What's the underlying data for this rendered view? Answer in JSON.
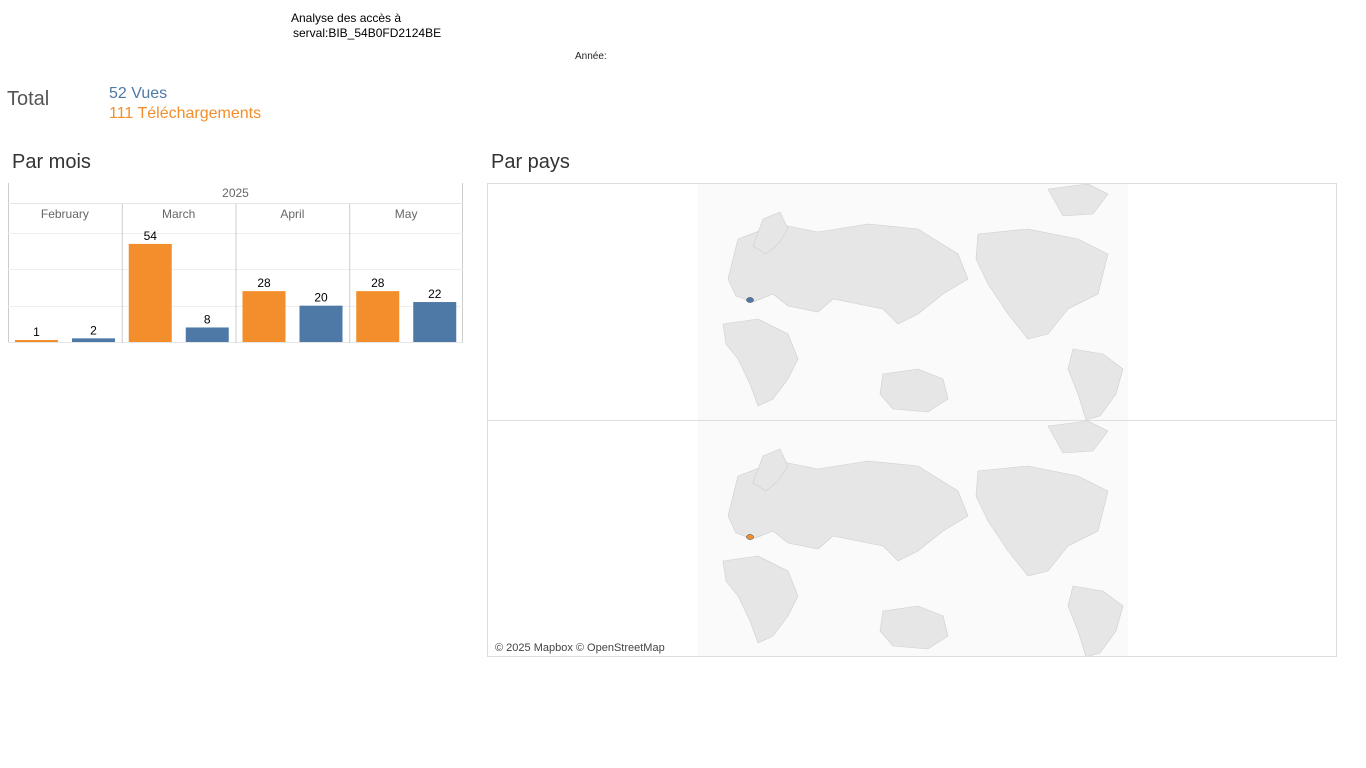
{
  "header": {
    "title_line1": "Analyse des accès à",
    "title_line2": "serval:BIB_54B0FD2124BE",
    "year_filter_label": "Année:"
  },
  "totals": {
    "label": "Total",
    "views_value": "52",
    "views_label": "Vues",
    "downloads_value": "111",
    "downloads_label": "Téléchargements"
  },
  "sections": {
    "by_month": "Par mois",
    "by_country": "Par pays"
  },
  "colors": {
    "views": "#4e79a7",
    "downloads": "#f28e2b"
  },
  "chart_data": {
    "type": "bar",
    "year": "2025",
    "categories": [
      "February",
      "March",
      "April",
      "May"
    ],
    "series": [
      {
        "name": "Téléchargements",
        "values": [
          1,
          54,
          28,
          28
        ]
      },
      {
        "name": "Vues",
        "values": [
          2,
          8,
          20,
          22
        ]
      }
    ],
    "ylim": [
      0,
      60
    ],
    "grid": true
  },
  "map": {
    "attribution": "© 2025 Mapbox © OpenStreetMap"
  }
}
